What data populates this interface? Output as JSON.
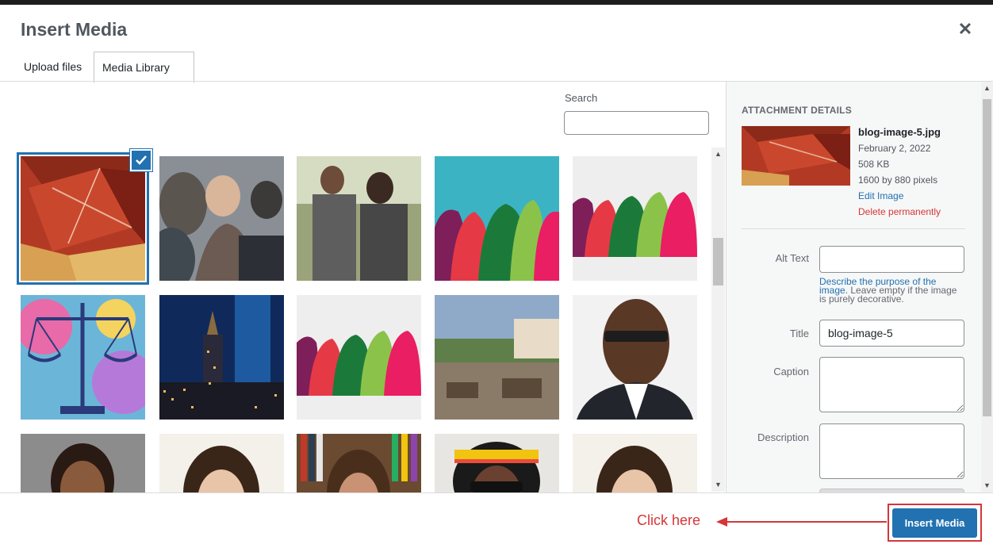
{
  "modal": {
    "title": "Insert Media",
    "close_icon": "close-icon"
  },
  "tabs": [
    {
      "label": "Upload files"
    },
    {
      "label": "Media Library"
    }
  ],
  "search": {
    "label": "Search",
    "value": ""
  },
  "grid": {
    "items": [
      {
        "name": "red-geometric-art-image",
        "selected": true
      },
      {
        "name": "crowd-blurred-image"
      },
      {
        "name": "friends-walking-image"
      },
      {
        "name": "colorful-silhouettes-image"
      },
      {
        "name": "colorful-silhouettes-image"
      },
      {
        "name": "justice-scales-image"
      },
      {
        "name": "city-night-skyline-image"
      },
      {
        "name": "colorful-silhouettes-image"
      },
      {
        "name": "resort-terrace-image"
      },
      {
        "name": "man-portrait-image"
      },
      {
        "name": "woman-portrait-image"
      },
      {
        "name": "woman-portrait-image"
      },
      {
        "name": "woman-bookshelf-image"
      },
      {
        "name": "man-headband-portrait-image"
      },
      {
        "name": "woman-portrait-image"
      }
    ]
  },
  "attachment": {
    "heading": "ATTACHMENT DETAILS",
    "filename": "blog-image-5.jpg",
    "date": "February 2, 2022",
    "size": "508 KB",
    "dimensions": "1600 by 880 pixels",
    "edit_label": "Edit Image",
    "delete_label": "Delete permanently",
    "fields": {
      "alt_label": "Alt Text",
      "alt_value": "",
      "alt_help_link": "Describe the purpose of the image",
      "alt_help_text": ". Leave empty if the image is purely decorative.",
      "title_label": "Title",
      "title_value": "blog-image-5",
      "caption_label": "Caption",
      "caption_value": "",
      "description_label": "Description",
      "description_value": ""
    }
  },
  "footer": {
    "annotation": "Click here",
    "insert_label": "Insert Media"
  },
  "colors": {
    "accent": "#2271b1",
    "annotation": "#d63638"
  }
}
